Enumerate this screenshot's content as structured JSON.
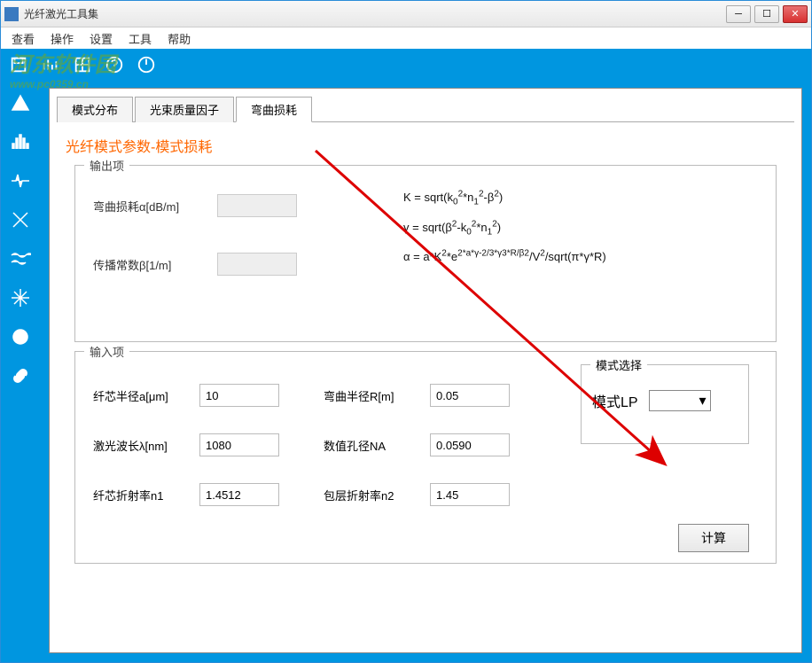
{
  "window": {
    "title": "光纤激光工具集"
  },
  "menu": {
    "view": "查看",
    "operate": "操作",
    "settings": "设置",
    "tools": "工具",
    "help": "帮助"
  },
  "watermark": {
    "line1": "河东软件园",
    "line2": "www.pc0359.cn"
  },
  "tabs": {
    "t1": "模式分布",
    "t2": "光束质量因子",
    "t3": "弯曲损耗"
  },
  "section_title": "光纤模式参数-模式损耗",
  "output": {
    "group_label": "输出项",
    "bend_loss_label": "弯曲损耗α[dB/m]",
    "prop_const_label": "传播常数β[1/m]"
  },
  "formulas": {
    "f1_html": "K = sqrt(k<span class='sub'>0</span><span class='sup'>2</span>*n<span class='sub'>1</span><span class='sup'>2</span>-β<span class='sup'>2</span>)",
    "f2_html": "γ = sqrt(β<span class='sup'>2</span>-k<span class='sub'>0</span><span class='sup'>2</span>*n<span class='sub'>1</span><span class='sup'>2</span>)",
    "f3_html": "α = a*K<span class='sup'>2</span>*e<span class='sup'>2*a*γ-2/3*γ3*R/β2</span>/V<span class='sup'>2</span>/sqrt(π*γ*R)"
  },
  "input": {
    "group_label": "输入项",
    "core_radius_label": "纤芯半径a[μm]",
    "core_radius_val": "10",
    "bend_radius_label": "弯曲半径R[m]",
    "bend_radius_val": "0.05",
    "wavelength_label": "激光波长λ[nm]",
    "wavelength_val": "1080",
    "na_label": "数值孔径NA",
    "na_val": "0.0590",
    "core_index_label": "纤芯折射率n1",
    "core_index_val": "1.4512",
    "clad_index_label": "包层折射率n2",
    "clad_index_val": "1.45"
  },
  "mode": {
    "group_label": "模式选择",
    "label": "模式LP",
    "value": ""
  },
  "buttons": {
    "calc": "计算"
  }
}
